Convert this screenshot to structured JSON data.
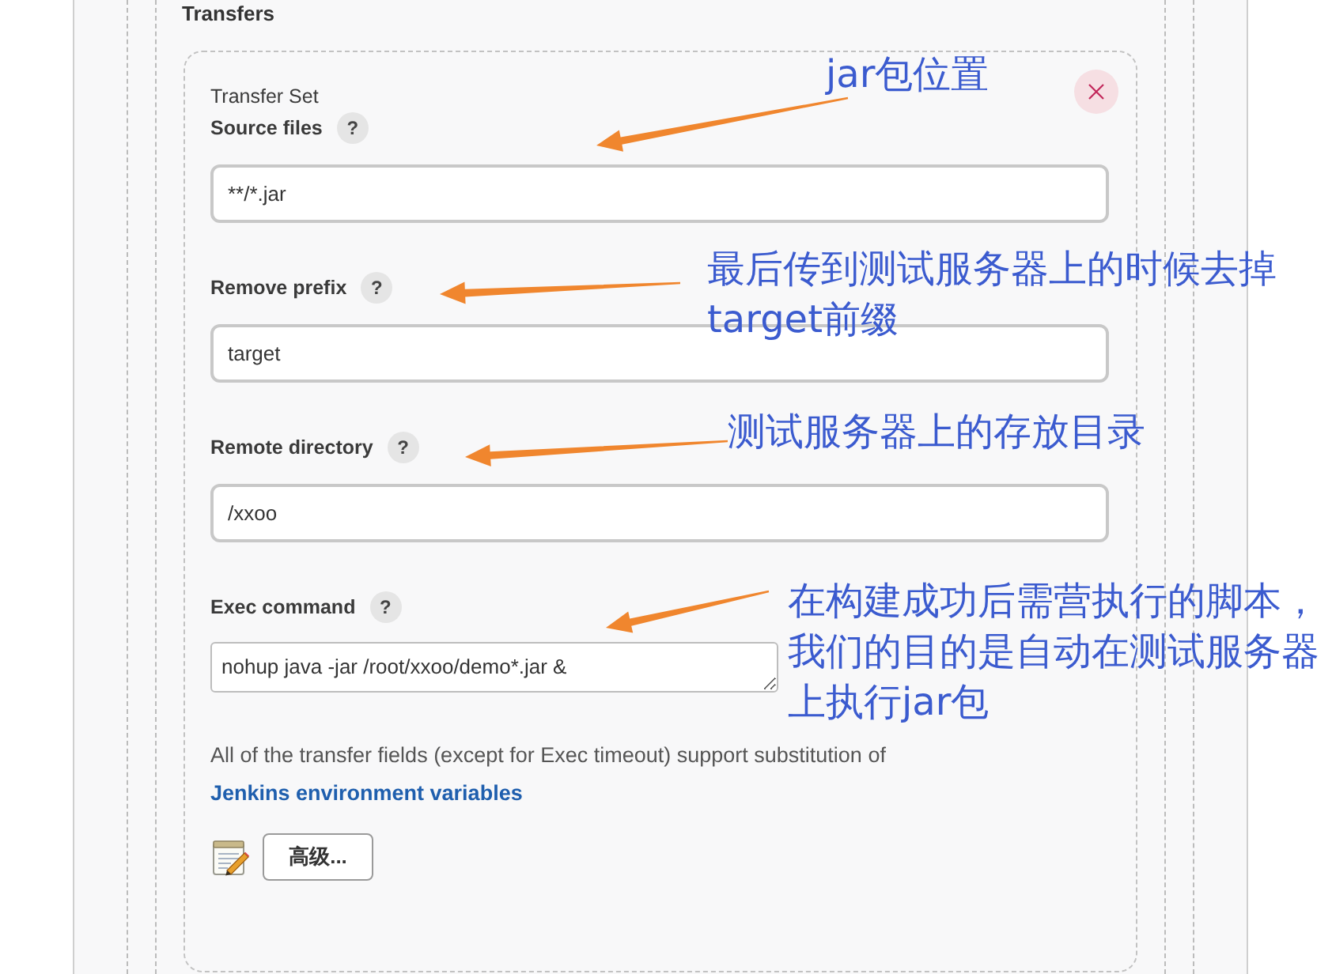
{
  "section": {
    "title": "Transfers"
  },
  "transfer_set": {
    "title": "Transfer Set"
  },
  "fields": [
    {
      "label": "Source files",
      "help": "?",
      "kind": "text",
      "value": "**/*.jar"
    },
    {
      "label": "Remove prefix",
      "help": "?",
      "kind": "text",
      "value": "target"
    },
    {
      "label": "Remote directory",
      "help": "?",
      "kind": "text",
      "value": "/xxoo"
    },
    {
      "label": "Exec command",
      "help": "?",
      "kind": "textarea",
      "value": "nohup java -jar /root/xxoo/demo*.jar &"
    }
  ],
  "note": {
    "text": "All of the transfer fields (except for Exec timeout) support substitution of",
    "link": "Jenkins environment variables"
  },
  "advanced_button": {
    "label": "高级..."
  },
  "annotations": [
    {
      "text": "jar包位置"
    },
    {
      "text": "最后传到测试服务器上的时候去掉target前缀"
    },
    {
      "text": "测试服务器上的存放目录"
    },
    {
      "text": "在构建成功后需营执行的脚本，我们的目的是自动在测试服务器上执行jar包"
    }
  ]
}
